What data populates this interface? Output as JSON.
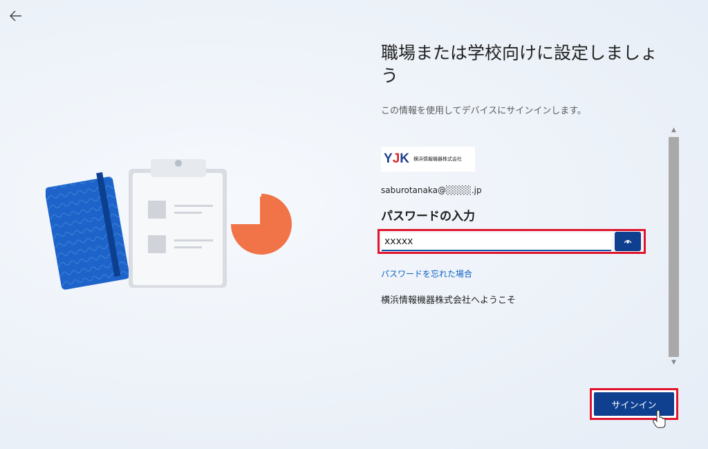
{
  "nav": {
    "back_icon": "back-arrow-icon"
  },
  "header": {
    "title": "職場または学校向けに設定しましょう",
    "subtitle": "この情報を使用してデバイスにサインインします。"
  },
  "org": {
    "logo_mark_1": "Y",
    "logo_mark_2": "J",
    "logo_mark_3": "K",
    "name": "横浜情報機器株式会社"
  },
  "account": {
    "email": "saburotanaka@░░░░.jp"
  },
  "password": {
    "heading": "パスワードの入力",
    "value": "xxxxx",
    "reveal_icon": "eye-icon"
  },
  "links": {
    "forgot": "パスワードを忘れた場合"
  },
  "welcome": "横浜情報機器株式会社へようこそ",
  "actions": {
    "signin": "サインイン"
  },
  "colors": {
    "accent": "#0f3f8f",
    "link": "#0a60c2",
    "highlight": "#e0142b"
  }
}
